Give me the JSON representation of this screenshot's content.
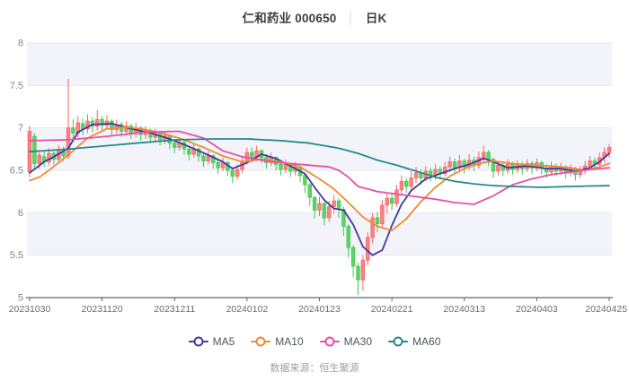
{
  "header": {
    "title": "仁和药业 000650",
    "separator": "│",
    "period": "日K"
  },
  "footer": {
    "source_label": "数据来源：恒生聚源"
  },
  "chart_data": {
    "type": "candlestick",
    "title": "仁和药业 000650 日K",
    "xlabel": "",
    "ylabel": "",
    "ylim": [
      5,
      8
    ],
    "y_ticks": [
      5,
      5.5,
      6,
      6.5,
      7,
      7.5,
      8
    ],
    "x_tick_labels": [
      "20231030",
      "20231120",
      "20231211",
      "20240102",
      "20240123",
      "20240221",
      "20240313",
      "20240403",
      "20240425"
    ],
    "x_tick_indices": [
      0,
      15,
      30,
      45,
      60,
      75,
      90,
      105,
      120
    ],
    "num_days": 121,
    "legend_position": "bottom",
    "grid": "horizontal-stripes",
    "colors": {
      "up_fill": "#f88484",
      "up_stroke": "#f36565",
      "down_fill": "#60d464",
      "down_stroke": "#42c653",
      "stripe": "#f2f4fa",
      "grid_line": "#e6e9f2",
      "axis_line": "#60666d",
      "x_label": "#666b72",
      "y_label": "#7f858d"
    },
    "candles": [
      [
        6.48,
        6.96,
        6.42,
        7.02
      ],
      [
        6.9,
        6.58,
        6.52,
        6.94
      ],
      [
        6.58,
        6.68,
        6.52,
        6.74
      ],
      [
        6.66,
        6.6,
        6.54,
        6.72
      ],
      [
        6.6,
        6.7,
        6.56,
        6.76
      ],
      [
        6.7,
        6.63,
        6.57,
        6.74
      ],
      [
        6.63,
        6.73,
        6.59,
        6.8
      ],
      [
        6.72,
        6.67,
        6.61,
        6.78
      ],
      [
        6.67,
        7.0,
        6.63,
        7.58
      ],
      [
        7.0,
        6.94,
        6.84,
        7.1
      ],
      [
        6.94,
        7.06,
        6.89,
        7.14
      ],
      [
        7.05,
        6.99,
        6.91,
        7.11
      ],
      [
        6.99,
        7.08,
        6.94,
        7.16
      ],
      [
        7.08,
        7.02,
        6.95,
        7.13
      ],
      [
        7.02,
        7.1,
        6.97,
        7.21
      ],
      [
        7.1,
        7.03,
        6.95,
        7.14
      ],
      [
        7.03,
        7.08,
        6.98,
        7.15
      ],
      [
        7.08,
        6.98,
        6.91,
        7.1
      ],
      [
        6.98,
        7.04,
        6.93,
        7.1
      ],
      [
        7.04,
        6.96,
        6.89,
        7.07
      ],
      [
        6.96,
        7.02,
        6.91,
        7.08
      ],
      [
        7.02,
        6.94,
        6.87,
        7.05
      ],
      [
        6.94,
        7.0,
        6.89,
        7.06
      ],
      [
        7.0,
        6.92,
        6.85,
        7.02
      ],
      [
        6.92,
        6.97,
        6.87,
        7.02
      ],
      [
        6.97,
        6.89,
        6.82,
        6.99
      ],
      [
        6.89,
        6.94,
        6.84,
        6.99
      ],
      [
        6.94,
        6.86,
        6.79,
        6.96
      ],
      [
        6.86,
        6.91,
        6.81,
        6.96
      ],
      [
        6.91,
        6.82,
        6.75,
        6.92
      ],
      [
        6.82,
        6.77,
        6.7,
        6.87
      ],
      [
        6.77,
        6.83,
        6.73,
        6.88
      ],
      [
        6.83,
        6.75,
        6.68,
        6.85
      ],
      [
        6.75,
        6.69,
        6.62,
        6.79
      ],
      [
        6.69,
        6.75,
        6.65,
        6.81
      ],
      [
        6.75,
        6.67,
        6.6,
        6.77
      ],
      [
        6.67,
        6.61,
        6.54,
        6.71
      ],
      [
        6.61,
        6.67,
        6.57,
        6.73
      ],
      [
        6.67,
        6.59,
        6.52,
        6.69
      ],
      [
        6.59,
        6.53,
        6.46,
        6.63
      ],
      [
        6.53,
        6.59,
        6.49,
        6.65
      ],
      [
        6.59,
        6.5,
        6.43,
        6.61
      ],
      [
        6.5,
        6.43,
        6.35,
        6.54
      ],
      [
        6.43,
        6.51,
        6.39,
        6.57
      ],
      [
        6.51,
        6.61,
        6.47,
        6.67
      ],
      [
        6.61,
        6.71,
        6.57,
        6.77
      ],
      [
        6.71,
        6.65,
        6.59,
        6.77
      ],
      [
        6.65,
        6.73,
        6.61,
        6.79
      ],
      [
        6.73,
        6.65,
        6.58,
        6.75
      ],
      [
        6.65,
        6.59,
        6.52,
        6.69
      ],
      [
        6.59,
        6.65,
        6.55,
        6.71
      ],
      [
        6.65,
        6.57,
        6.5,
        6.67
      ],
      [
        6.57,
        6.51,
        6.44,
        6.61
      ],
      [
        6.51,
        6.57,
        6.47,
        6.63
      ],
      [
        6.57,
        6.49,
        6.42,
        6.59
      ],
      [
        6.49,
        6.54,
        6.44,
        6.6
      ],
      [
        6.54,
        6.44,
        6.36,
        6.56
      ],
      [
        6.44,
        6.33,
        6.23,
        6.46
      ],
      [
        6.33,
        6.18,
        6.08,
        6.35
      ],
      [
        6.18,
        6.03,
        5.93,
        6.2
      ],
      [
        6.03,
        6.11,
        5.96,
        6.19
      ],
      [
        6.11,
        5.94,
        5.85,
        6.13
      ],
      [
        5.94,
        6.07,
        5.89,
        6.14
      ],
      [
        6.07,
        6.14,
        5.99,
        6.21
      ],
      [
        6.14,
        6.04,
        5.94,
        6.17
      ],
      [
        6.04,
        5.84,
        5.73,
        6.07
      ],
      [
        5.84,
        5.59,
        5.47,
        5.87
      ],
      [
        5.59,
        5.37,
        5.24,
        5.62
      ],
      [
        5.37,
        5.21,
        5.03,
        5.41
      ],
      [
        5.21,
        5.44,
        5.08,
        5.5
      ],
      [
        5.44,
        5.71,
        5.38,
        5.77
      ],
      [
        5.71,
        5.94,
        5.64,
        6.0
      ],
      [
        5.94,
        5.87,
        5.77,
        6.01
      ],
      [
        5.87,
        6.09,
        5.83,
        6.15
      ],
      [
        6.09,
        6.17,
        5.99,
        6.24
      ],
      [
        6.17,
        6.11,
        6.03,
        6.23
      ],
      [
        6.11,
        6.27,
        6.07,
        6.33
      ],
      [
        6.27,
        6.37,
        6.21,
        6.44
      ],
      [
        6.37,
        6.31,
        6.23,
        6.41
      ],
      [
        6.31,
        6.41,
        6.27,
        6.49
      ],
      [
        6.41,
        6.47,
        6.35,
        6.54
      ],
      [
        6.47,
        6.41,
        6.33,
        6.51
      ],
      [
        6.41,
        6.49,
        6.37,
        6.55
      ],
      [
        6.49,
        6.44,
        6.37,
        6.53
      ],
      [
        6.44,
        6.51,
        6.39,
        6.57
      ],
      [
        6.51,
        6.46,
        6.39,
        6.55
      ],
      [
        6.46,
        6.54,
        6.42,
        6.6
      ],
      [
        6.54,
        6.6,
        6.48,
        6.66
      ],
      [
        6.6,
        6.53,
        6.46,
        6.64
      ],
      [
        6.53,
        6.61,
        6.49,
        6.68
      ],
      [
        6.61,
        6.54,
        6.46,
        6.64
      ],
      [
        6.54,
        6.62,
        6.5,
        6.69
      ],
      [
        6.62,
        6.56,
        6.49,
        6.66
      ],
      [
        6.56,
        6.65,
        6.52,
        6.72
      ],
      [
        6.65,
        6.71,
        6.59,
        6.79
      ],
      [
        6.71,
        6.63,
        6.55,
        6.74
      ],
      [
        6.63,
        6.49,
        6.41,
        6.65
      ],
      [
        6.49,
        6.56,
        6.44,
        6.61
      ],
      [
        6.56,
        6.5,
        6.43,
        6.59
      ],
      [
        6.5,
        6.57,
        6.46,
        6.63
      ],
      [
        6.57,
        6.51,
        6.45,
        6.6
      ],
      [
        6.51,
        6.57,
        6.47,
        6.62
      ],
      [
        6.57,
        6.52,
        6.45,
        6.6
      ],
      [
        6.52,
        6.58,
        6.48,
        6.63
      ],
      [
        6.58,
        6.53,
        6.46,
        6.61
      ],
      [
        6.53,
        6.59,
        6.49,
        6.64
      ],
      [
        6.59,
        6.53,
        6.45,
        6.61
      ],
      [
        6.53,
        6.48,
        6.41,
        6.57
      ],
      [
        6.48,
        6.55,
        6.44,
        6.6
      ],
      [
        6.55,
        6.49,
        6.43,
        6.58
      ],
      [
        6.49,
        6.54,
        6.45,
        6.59
      ],
      [
        6.54,
        6.47,
        6.4,
        6.56
      ],
      [
        6.47,
        6.52,
        6.43,
        6.57
      ],
      [
        6.52,
        6.45,
        6.38,
        6.54
      ],
      [
        6.45,
        6.5,
        6.41,
        6.55
      ],
      [
        6.5,
        6.55,
        6.45,
        6.61
      ],
      [
        6.55,
        6.61,
        6.51,
        6.67
      ],
      [
        6.61,
        6.57,
        6.51,
        6.65
      ],
      [
        6.57,
        6.65,
        6.53,
        6.71
      ],
      [
        6.65,
        6.71,
        6.59,
        6.77
      ],
      [
        6.71,
        6.77,
        6.65,
        6.81
      ]
    ],
    "ma_series": [
      {
        "name": "MA5",
        "color": "#45379f",
        "points": [
          [
            0,
            6.47
          ],
          [
            3,
            6.6
          ],
          [
            5,
            6.66
          ],
          [
            8,
            6.76
          ],
          [
            10,
            6.95
          ],
          [
            13,
            7.04
          ],
          [
            17,
            7.05
          ],
          [
            21,
            6.99
          ],
          [
            25,
            6.94
          ],
          [
            29,
            6.87
          ],
          [
            33,
            6.78
          ],
          [
            37,
            6.68
          ],
          [
            40,
            6.6
          ],
          [
            42,
            6.52
          ],
          [
            45,
            6.59
          ],
          [
            48,
            6.69
          ],
          [
            51,
            6.64
          ],
          [
            54,
            6.55
          ],
          [
            57,
            6.46
          ],
          [
            59,
            6.3
          ],
          [
            61,
            6.15
          ],
          [
            63,
            6.05
          ],
          [
            65,
            6.03
          ],
          [
            67,
            5.86
          ],
          [
            69,
            5.6
          ],
          [
            71,
            5.5
          ],
          [
            73,
            5.56
          ],
          [
            75,
            5.85
          ],
          [
            77,
            6.1
          ],
          [
            79,
            6.26
          ],
          [
            82,
            6.4
          ],
          [
            85,
            6.46
          ],
          [
            88,
            6.52
          ],
          [
            91,
            6.57
          ],
          [
            94,
            6.64
          ],
          [
            96,
            6.6
          ],
          [
            99,
            6.53
          ],
          [
            103,
            6.55
          ],
          [
            107,
            6.52
          ],
          [
            110,
            6.52
          ],
          [
            113,
            6.49
          ],
          [
            116,
            6.53
          ],
          [
            118,
            6.6
          ],
          [
            120,
            6.7
          ]
        ]
      },
      {
        "name": "MA10",
        "color": "#ef8b31",
        "points": [
          [
            0,
            6.38
          ],
          [
            2,
            6.42
          ],
          [
            4,
            6.5
          ],
          [
            8,
            6.68
          ],
          [
            12,
            6.88
          ],
          [
            16,
            6.99
          ],
          [
            20,
            7.01
          ],
          [
            24,
            6.98
          ],
          [
            28,
            6.93
          ],
          [
            32,
            6.86
          ],
          [
            36,
            6.77
          ],
          [
            40,
            6.67
          ],
          [
            44,
            6.6
          ],
          [
            48,
            6.63
          ],
          [
            52,
            6.6
          ],
          [
            56,
            6.54
          ],
          [
            60,
            6.4
          ],
          [
            63,
            6.28
          ],
          [
            66,
            6.12
          ],
          [
            69,
            5.95
          ],
          [
            72,
            5.84
          ],
          [
            75,
            5.79
          ],
          [
            78,
            5.93
          ],
          [
            81,
            6.13
          ],
          [
            84,
            6.3
          ],
          [
            87,
            6.43
          ],
          [
            90,
            6.52
          ],
          [
            93,
            6.58
          ],
          [
            96,
            6.61
          ],
          [
            100,
            6.58
          ],
          [
            104,
            6.56
          ],
          [
            108,
            6.55
          ],
          [
            112,
            6.53
          ],
          [
            115,
            6.5
          ],
          [
            118,
            6.54
          ],
          [
            120,
            6.58
          ]
        ]
      },
      {
        "name": "MA30",
        "color": "#e94fa5",
        "points": [
          [
            0,
            6.85
          ],
          [
            8,
            6.86
          ],
          [
            16,
            6.9
          ],
          [
            24,
            6.95
          ],
          [
            31,
            6.96
          ],
          [
            36,
            6.88
          ],
          [
            40,
            6.73
          ],
          [
            44,
            6.66
          ],
          [
            48,
            6.62
          ],
          [
            52,
            6.59
          ],
          [
            58,
            6.56
          ],
          [
            62,
            6.54
          ],
          [
            64,
            6.5
          ],
          [
            66,
            6.42
          ],
          [
            68,
            6.31
          ],
          [
            72,
            6.25
          ],
          [
            76,
            6.22
          ],
          [
            80,
            6.19
          ],
          [
            84,
            6.16
          ],
          [
            88,
            6.12
          ],
          [
            92,
            6.1
          ],
          [
            96,
            6.2
          ],
          [
            100,
            6.33
          ],
          [
            104,
            6.4
          ],
          [
            108,
            6.45
          ],
          [
            112,
            6.48
          ],
          [
            116,
            6.51
          ],
          [
            120,
            6.53
          ]
        ]
      },
      {
        "name": "MA60",
        "color": "#27898d",
        "points": [
          [
            0,
            6.72
          ],
          [
            8,
            6.75
          ],
          [
            16,
            6.79
          ],
          [
            24,
            6.83
          ],
          [
            31,
            6.86
          ],
          [
            38,
            6.87
          ],
          [
            45,
            6.87
          ],
          [
            52,
            6.85
          ],
          [
            58,
            6.82
          ],
          [
            64,
            6.76
          ],
          [
            68,
            6.7
          ],
          [
            72,
            6.62
          ],
          [
            76,
            6.56
          ],
          [
            80,
            6.49
          ],
          [
            84,
            6.42
          ],
          [
            88,
            6.37
          ],
          [
            92,
            6.34
          ],
          [
            96,
            6.32
          ],
          [
            100,
            6.31
          ],
          [
            106,
            6.3
          ],
          [
            112,
            6.31
          ],
          [
            120,
            6.32
          ]
        ]
      }
    ]
  }
}
